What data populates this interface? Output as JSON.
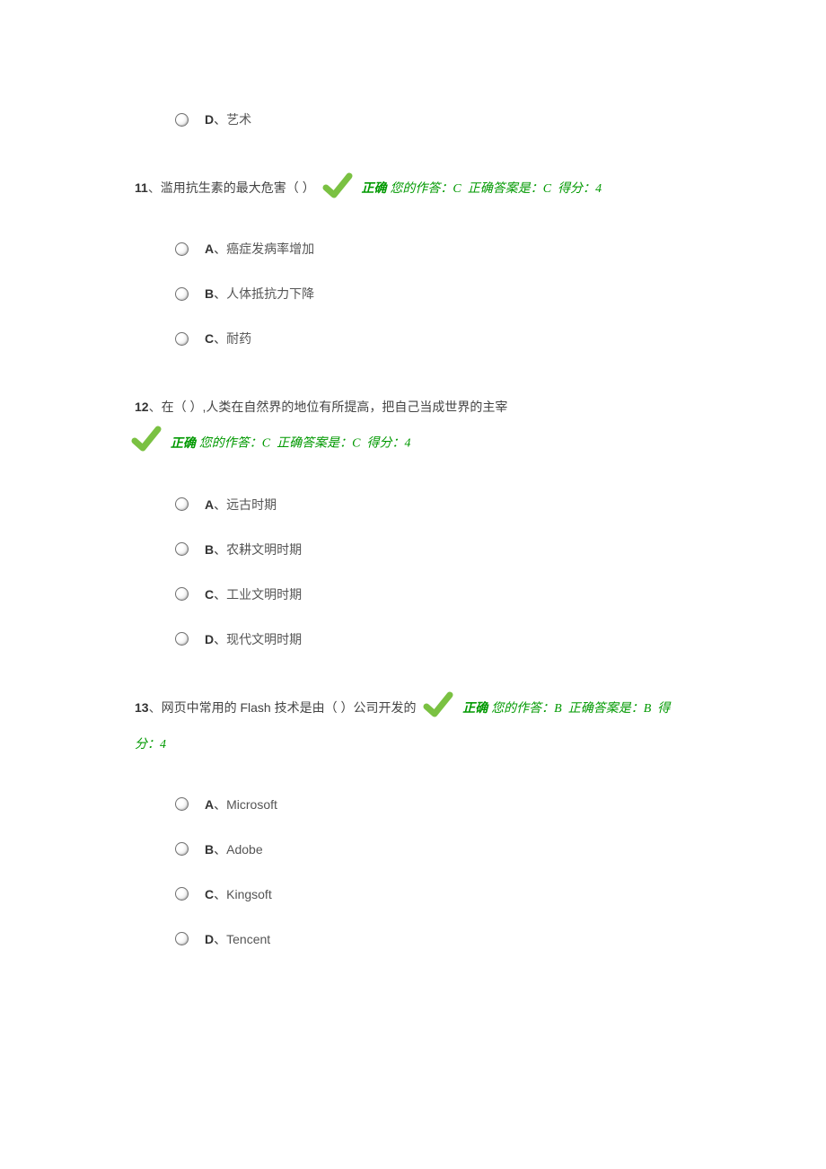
{
  "orphan_option": {
    "letter": "D",
    "text": "艺术"
  },
  "questions": [
    {
      "number": "11",
      "stem": "滥用抗生素的最大危害（ ）",
      "status": "正确",
      "your_answer_label": "您的作答：",
      "your_answer_value": "C",
      "correct_answer_label": "正确答案是：",
      "correct_answer_value": "C",
      "score_label": "得分：",
      "score_value": "4",
      "options": [
        {
          "letter": "A",
          "text": "癌症发病率增加"
        },
        {
          "letter": "B",
          "text": "人体抵抗力下降"
        },
        {
          "letter": "C",
          "text": "耐药"
        }
      ]
    },
    {
      "number": "12",
      "stem": "在（ ）,人类在自然界的地位有所提高，把自己当成世界的主宰",
      "status": "正确",
      "your_answer_label": "您的作答：",
      "your_answer_value": "C",
      "correct_answer_label": "正确答案是：",
      "correct_answer_value": "C",
      "score_label": "得分：",
      "score_value": "4",
      "options": [
        {
          "letter": "A",
          "text": "远古时期"
        },
        {
          "letter": "B",
          "text": "农耕文明时期"
        },
        {
          "letter": "C",
          "text": "工业文明时期"
        },
        {
          "letter": "D",
          "text": "现代文明时期"
        }
      ]
    },
    {
      "number": "13",
      "stem": "网页中常用的 Flash 技术是由（ ）公司开发的",
      "status": "正确",
      "your_answer_label": "您的作答：",
      "your_answer_value": "B",
      "correct_answer_label": "正确答案是：",
      "correct_answer_value": "B",
      "score_label": "得分：",
      "score_value": "4",
      "options": [
        {
          "letter": "A",
          "text": "Microsoft"
        },
        {
          "letter": "B",
          "text": "Adobe"
        },
        {
          "letter": "C",
          "text": "Kingsoft"
        },
        {
          "letter": "D",
          "text": "Tencent"
        }
      ]
    }
  ]
}
